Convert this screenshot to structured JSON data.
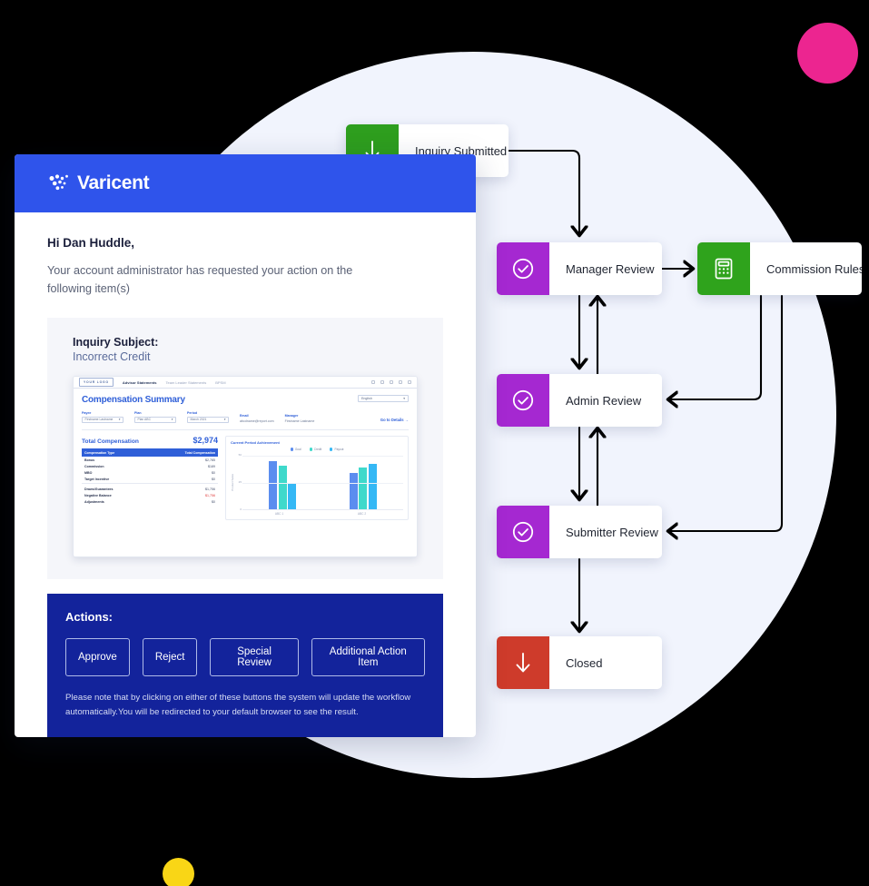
{
  "decor": {
    "background_circle_color": "#F1F4FD",
    "pink_dot_color": "#EC2590",
    "yellow_dot_color": "#F9D616"
  },
  "email": {
    "brand": "Varicent",
    "brand_color": "#2F54EB",
    "greeting": "Hi Dan Huddle,",
    "intro": "Your account administrator has requested your action on the following item(s)",
    "inquiry_label": "Inquiry Subject:",
    "inquiry_value": "Incorrect Credit",
    "actions_title": "Actions:",
    "buttons": [
      {
        "label": "Approve"
      },
      {
        "label": "Reject"
      },
      {
        "label": "Special Review"
      },
      {
        "label": "Additional Action Item"
      }
    ],
    "note": "Please note that by clicking on either of these buttons the system will update the workflow automatically.You will be redirected to your default browser to see the result."
  },
  "dashboard": {
    "logo": "YOUR LOGO",
    "nav": [
      {
        "label": "Advisor Statements",
        "active": true
      },
      {
        "label": "Team Leader Statements",
        "active": false
      },
      {
        "label": "BPSM",
        "active": false
      }
    ],
    "title": "Compensation Summary",
    "language": "English",
    "fields": [
      {
        "label": "Payee",
        "value": "Firstname Lastname",
        "type": "select"
      },
      {
        "label": "Plan",
        "value": "Plan ABC",
        "type": "select"
      },
      {
        "label": "Period",
        "value": "March 2021",
        "type": "select"
      },
      {
        "label": "Email",
        "value": "abcdname@report.com",
        "type": "text"
      },
      {
        "label": "Manager",
        "value": "Firstname Lastname",
        "type": "text"
      }
    ],
    "details_link": "Go to Details →",
    "total_label": "Total Compensation",
    "total_value": "$2,974",
    "table": {
      "headers": [
        "Compensation Type",
        "Total Compensation"
      ],
      "rows": [
        {
          "type": "Bonus",
          "amount": "$2,785",
          "negative": false
        },
        {
          "type": "Commission",
          "amount": "$189",
          "negative": false
        },
        {
          "type": "MBO",
          "amount": "$0",
          "negative": false
        },
        {
          "type": "Target Incentive",
          "amount": "$0",
          "negative": false
        }
      ],
      "rows2": [
        {
          "type": "Draws/Guarantees",
          "amount": "$1,756",
          "negative": false
        },
        {
          "type": "Negative Balance",
          "amount": "$1,756",
          "negative": true
        },
        {
          "type": "Adjustments",
          "amount": "$0",
          "negative": false
        }
      ]
    },
    "chart_data": {
      "type": "bar",
      "title": "Current Period Achievement",
      "xlabel": "",
      "ylabel": "Product Sales",
      "categories": [
        "ABC 1",
        "ABC 2"
      ],
      "series": [
        {
          "name": "Goal",
          "color": "#5B8DEF",
          "values": [
            48,
            36
          ]
        },
        {
          "name": "Credit",
          "color": "#3FD9CB",
          "values": [
            43,
            42
          ]
        },
        {
          "name": "Payout",
          "color": "#35B8F5",
          "values": [
            26,
            45
          ]
        }
      ],
      "ytick_labels": [
        "0",
        "25",
        "50"
      ],
      "ylim": [
        0,
        55
      ],
      "grid": true,
      "legend_position": "top"
    }
  },
  "flow": {
    "nodes": [
      {
        "id": "inquiry",
        "label": "Inquiry Submitted",
        "icon": "arrow-down-icon",
        "color": "#2E9E1E"
      },
      {
        "id": "manager",
        "label": "Manager Review",
        "icon": "check-circle-icon",
        "color": "#A528D1"
      },
      {
        "id": "rules",
        "label": "Commission Rules",
        "icon": "calculator-icon",
        "color": "#2FA31C"
      },
      {
        "id": "admin",
        "label": "Admin Review",
        "icon": "check-circle-icon",
        "color": "#A528D1"
      },
      {
        "id": "submitter",
        "label": "Submitter Review",
        "icon": "check-circle-icon",
        "color": "#A528D1"
      },
      {
        "id": "closed",
        "label": "Closed",
        "icon": "arrow-down-icon",
        "color": "#CE3B2B"
      }
    ]
  }
}
